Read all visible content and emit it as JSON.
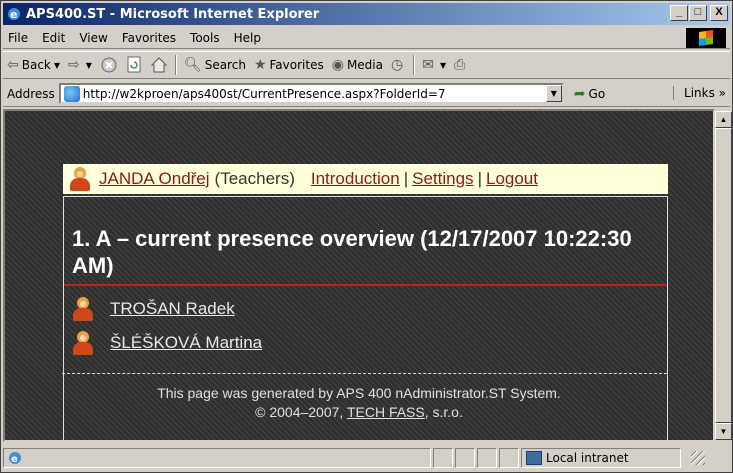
{
  "window": {
    "title": "APS400.ST - Microsoft Internet Explorer",
    "buttons": {
      "minimize": "_",
      "maximize": "□",
      "close": "X"
    }
  },
  "menu": [
    "File",
    "Edit",
    "View",
    "Favorites",
    "Tools",
    "Help"
  ],
  "toolbar": {
    "back": "Back",
    "search": "Search",
    "favorites": "Favorites",
    "media": "Media"
  },
  "address": {
    "label": "Address",
    "url": "http://w2kproen/aps400st/CurrentPresence.aspx?FolderId=7",
    "go": "Go",
    "links": "Links »"
  },
  "page": {
    "user": {
      "name": "JANDA Ondřej",
      "group": "(Teachers)"
    },
    "nav": {
      "introduction": "Introduction",
      "settings": "Settings",
      "logout": "Logout",
      "separator": "|"
    },
    "heading": "1. A – current presence overview (12/17/2007 10:22:30 AM)",
    "people": [
      "TROŠAN Radek",
      "ŠLÉŠKOVÁ Martina"
    ],
    "footer": {
      "line1": "This page was generated by APS 400 nAdministrator.ST System.",
      "copyright_prefix": "© 2004–2007, ",
      "company_link": "TECH FASS",
      "copyright_suffix": ", s.r.o."
    }
  },
  "status": {
    "zone": "Local intranet"
  },
  "colors": {
    "title_gradient_start": "#0a246a",
    "userbar_bg": "#ffffd9",
    "link_dark_red": "#8b1a1a",
    "heading_rule": "#c02020",
    "content_bg": "#2f2f2f"
  }
}
